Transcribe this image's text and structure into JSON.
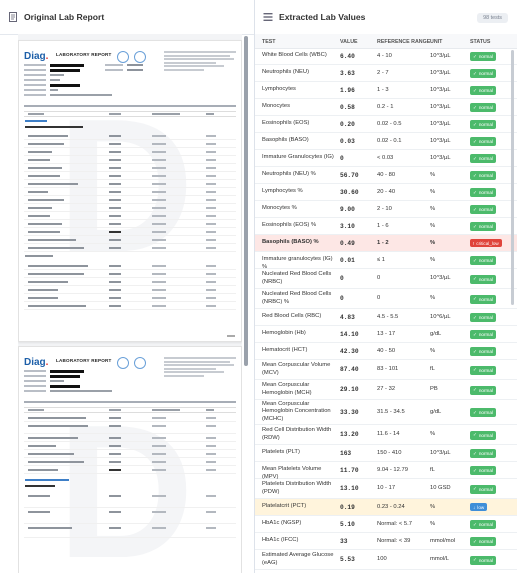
{
  "left_panel": {
    "title": "Original Lab Report"
  },
  "report": {
    "title": "LABORATORY REPORT",
    "logo": "Diag"
  },
  "right_panel": {
    "title": "Extracted Lab Values",
    "count_badge": "98 tests",
    "columns": [
      "TEST",
      "VALUE",
      "REFERENCE RANGE",
      "UNIT",
      "STATUS"
    ]
  },
  "status_colors": {
    "normal": "#4cba6b",
    "critical": "#e0443b",
    "low": "#3f8ed8"
  },
  "rows": [
    {
      "test": "White Blood Cells (WBC)",
      "value": "6.40",
      "ref": "4 - 10",
      "unit": "10^3/µL",
      "status": "normal",
      "h": 16
    },
    {
      "test": "Neutrophils (NEU)",
      "value": "3.63",
      "ref": "2 - 7",
      "unit": "10^3/µL",
      "status": "normal",
      "h": 16
    },
    {
      "test": "Lymphocytes",
      "value": "1.96",
      "ref": "1 - 3",
      "unit": "10^3/µL",
      "status": "normal",
      "h": 16
    },
    {
      "test": "Monocytes",
      "value": "0.58",
      "ref": "0.2 - 1",
      "unit": "10^3/µL",
      "status": "normal",
      "h": 16
    },
    {
      "test": "Eosinophils (EOS)",
      "value": "0.20",
      "ref": "0.02 - 0.5",
      "unit": "10^3/µL",
      "status": "normal",
      "h": 16
    },
    {
      "test": "Basophils (BASO)",
      "value": "0.03",
      "ref": "0.02 - 0.1",
      "unit": "10^3/µL",
      "status": "normal",
      "h": 16
    },
    {
      "test": "Immature Granulocytes (IG)",
      "value": "0",
      "ref": "< 0.03",
      "unit": "10^3/µL",
      "status": "normal",
      "h": 16
    },
    {
      "test": "Neutrophils (NEU) %",
      "value": "56.70",
      "ref": "40 - 80",
      "unit": "%",
      "status": "normal",
      "h": 16
    },
    {
      "test": "Lymphocytes %",
      "value": "30.60",
      "ref": "20 - 40",
      "unit": "%",
      "status": "normal",
      "h": 16
    },
    {
      "test": "Monocytes %",
      "value": "9.00",
      "ref": "2 - 10",
      "unit": "%",
      "status": "normal",
      "h": 16
    },
    {
      "test": "Eosinophils (EOS) %",
      "value": "3.10",
      "ref": "1 - 6",
      "unit": "%",
      "status": "normal",
      "h": 16
    },
    {
      "test": "Basophils (BASO) %",
      "value": "0.49",
      "ref": "1 - 2",
      "unit": "%",
      "status": "critical_low",
      "h": 16
    },
    {
      "test": "Immature granulocytes (IG) %",
      "value": "0.01",
      "ref": "≤ 1",
      "unit": "%",
      "status": "normal",
      "h": 16
    },
    {
      "test": "Nucleated Red Blood Cells (NRBC)",
      "value": "0",
      "ref": "0",
      "unit": "10^3/µL",
      "status": "normal",
      "h": 19
    },
    {
      "test": "Nucleated Red Blood Cells (NRBC) %",
      "value": "0",
      "ref": "0",
      "unit": "%",
      "status": "normal",
      "h": 19
    },
    {
      "test": "Red Blood Cells (RBC)",
      "value": "4.83",
      "ref": "4.5 - 5.5",
      "unit": "10^6/µL",
      "status": "normal",
      "h": 16
    },
    {
      "test": "Hemoglobin (Hb)",
      "value": "14.10",
      "ref": "13 - 17",
      "unit": "g/dL",
      "status": "normal",
      "h": 16
    },
    {
      "test": "Hematocrit (HCT)",
      "value": "42.30",
      "ref": "40 - 50",
      "unit": "%",
      "status": "normal",
      "h": 16
    },
    {
      "test": "Mean Corpuscular Volume (MCV)",
      "value": "87.40",
      "ref": "83 - 101",
      "unit": "fL",
      "status": "normal",
      "h": 19
    },
    {
      "test": "Mean Corpuscular Hemoglobin (MCH)",
      "value": "29.10",
      "ref": "27 - 32",
      "unit": "PB",
      "status": "normal",
      "h": 19
    },
    {
      "test": "Mean Corpuscular Hemoglobin Concentration (MCHC)",
      "value": "33.30",
      "ref": "31.5 - 34.5",
      "unit": "g/dL",
      "status": "normal",
      "h": 24
    },
    {
      "test": "Red Cell Distribution Width (RDW)",
      "value": "13.20",
      "ref": "11.6 - 14",
      "unit": "%",
      "status": "normal",
      "h": 19
    },
    {
      "test": "Platelets (PLT)",
      "value": "163",
      "ref": "150 - 410",
      "unit": "10^3/µL",
      "status": "normal",
      "h": 16
    },
    {
      "test": "Mean Platelets Volume (MPV)",
      "value": "11.70",
      "ref": "9.04 - 12.79",
      "unit": "fL",
      "status": "normal",
      "h": 16
    },
    {
      "test": "Platelets Distribution Width (PDW)",
      "value": "13.10",
      "ref": "10 - 17",
      "unit": "10 GSD",
      "status": "normal",
      "h": 19
    },
    {
      "test": "Platelatcrit (PCT)",
      "value": "0.19",
      "ref": "0.23 - 0.24",
      "unit": "%",
      "status": "low",
      "h": 16
    },
    {
      "test": "HbA1c (NGSP)",
      "value": "5.10",
      "ref": "Normal: < 5.7",
      "unit": "%",
      "status": "normal",
      "h": 16
    },
    {
      "test": "HbA1c (IFCC)",
      "value": "33",
      "ref": "Normal: < 39",
      "unit": "mmol/mol",
      "status": "normal",
      "h": 16
    },
    {
      "test": "Estimated Average Glucose (eAG)",
      "value": "5.53",
      "ref": "100",
      "unit": "mmol/L",
      "status": "normal",
      "h": 19
    }
  ],
  "status_labels": {
    "normal": "normal",
    "critical_low": "critical_low",
    "low": "low"
  }
}
